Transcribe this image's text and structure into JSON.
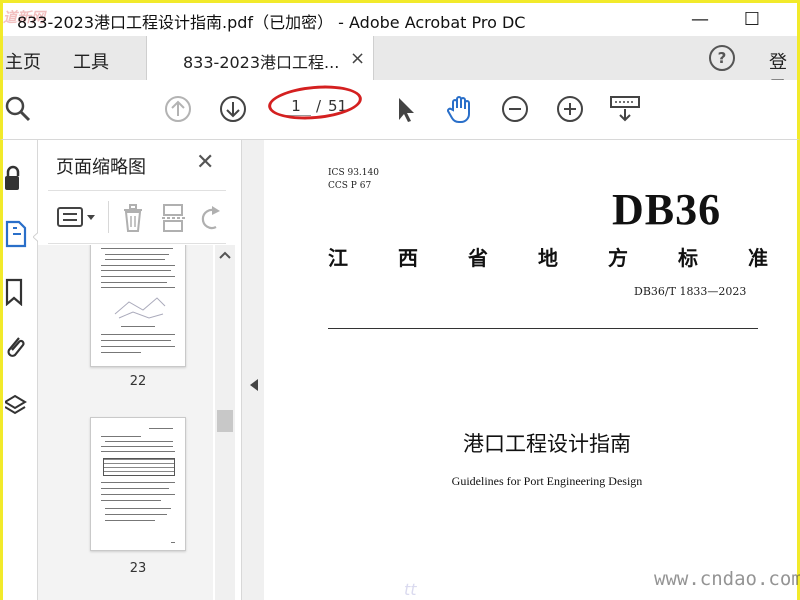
{
  "window": {
    "title": "833-2023港口工程设计指南.pdf（已加密） - Adobe Acrobat Pro DC",
    "logo_text": "道新网",
    "minimize_glyph": "—",
    "maximize_glyph": "☐"
  },
  "menubar": {
    "home_label": "主页",
    "tools_label": "工具",
    "tab_label": "833-2023港口工程...",
    "tab_close": "×",
    "help_glyph": "?",
    "login_label": "登录"
  },
  "toolbar": {
    "current_page": "1",
    "page_separator": "/",
    "total_pages": "51",
    "icons": [
      "search-icon",
      "prev-page-icon",
      "next-page-icon",
      "select-cursor-icon",
      "hand-tool-icon",
      "zoom-out-icon",
      "zoom-in-icon",
      "keyboard-icon"
    ]
  },
  "left_rail": {
    "icons": [
      "lock-icon",
      "pages-icon",
      "bookmark-icon",
      "attachment-icon",
      "layers-icon"
    ],
    "active": "pages-icon"
  },
  "thumbnail_panel": {
    "title": "页面缩略图",
    "close_glyph": "✕",
    "thumbnails": [
      {
        "page_label": "22"
      },
      {
        "page_label": "23"
      }
    ]
  },
  "document": {
    "ics": "ICS  93.140",
    "ccs": "CCS  P  67",
    "code": "DB36",
    "standard_chars": [
      "江",
      "西",
      "省",
      "地",
      "方",
      "标",
      "准"
    ],
    "standard_number": "DB36/T  1833—2023",
    "cn_title": "港口工程设计指南",
    "en_title": "Guidelines for Port Engineering Design",
    "watermark": "www.cndao.com",
    "faint_mark": "tt"
  },
  "colors": {
    "highlight_border": "#f2ea2a",
    "annotation": "#d42020",
    "accent": "#2a6fc9"
  }
}
